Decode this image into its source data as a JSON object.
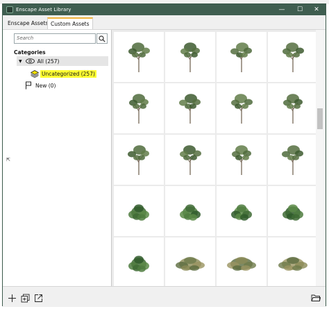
{
  "window": {
    "title": "Enscape Asset Library",
    "controls": {
      "minimize": "—",
      "maximize": "☐",
      "close": "✕"
    }
  },
  "tabs": [
    {
      "label": "Enscape Assets",
      "active": false
    },
    {
      "label": "Custom Assets",
      "active": true
    }
  ],
  "search": {
    "placeholder": "Search",
    "icon": "search-icon"
  },
  "categories": {
    "title": "Categories",
    "all": {
      "label": "All (257)",
      "icon": "eye-icon"
    },
    "uncategorized": {
      "label": "Uncategorized (257)",
      "icon": "layers-icon"
    },
    "new": {
      "label": "New (0)",
      "icon": "flag-icon"
    }
  },
  "collapse_glyph": "⇱",
  "assets": [
    {
      "kind": "tree"
    },
    {
      "kind": "tree"
    },
    {
      "kind": "tree"
    },
    {
      "kind": "tree"
    },
    {
      "kind": "tree"
    },
    {
      "kind": "tree"
    },
    {
      "kind": "tree"
    },
    {
      "kind": "tree"
    },
    {
      "kind": "tree"
    },
    {
      "kind": "tree"
    },
    {
      "kind": "tree"
    },
    {
      "kind": "tree"
    },
    {
      "kind": "shrub"
    },
    {
      "kind": "shrub"
    },
    {
      "kind": "shrub"
    },
    {
      "kind": "shrub"
    },
    {
      "kind": "shrub"
    },
    {
      "kind": "bush"
    },
    {
      "kind": "bush"
    },
    {
      "kind": "bush"
    }
  ],
  "bottom_toolbar": [
    "add-icon",
    "duplicate-icon",
    "export-icon",
    "folder-icon"
  ],
  "colors": {
    "titlebar": "#3f5e50",
    "tab_accent": "#f2b43d",
    "highlight": "#ffff33"
  }
}
